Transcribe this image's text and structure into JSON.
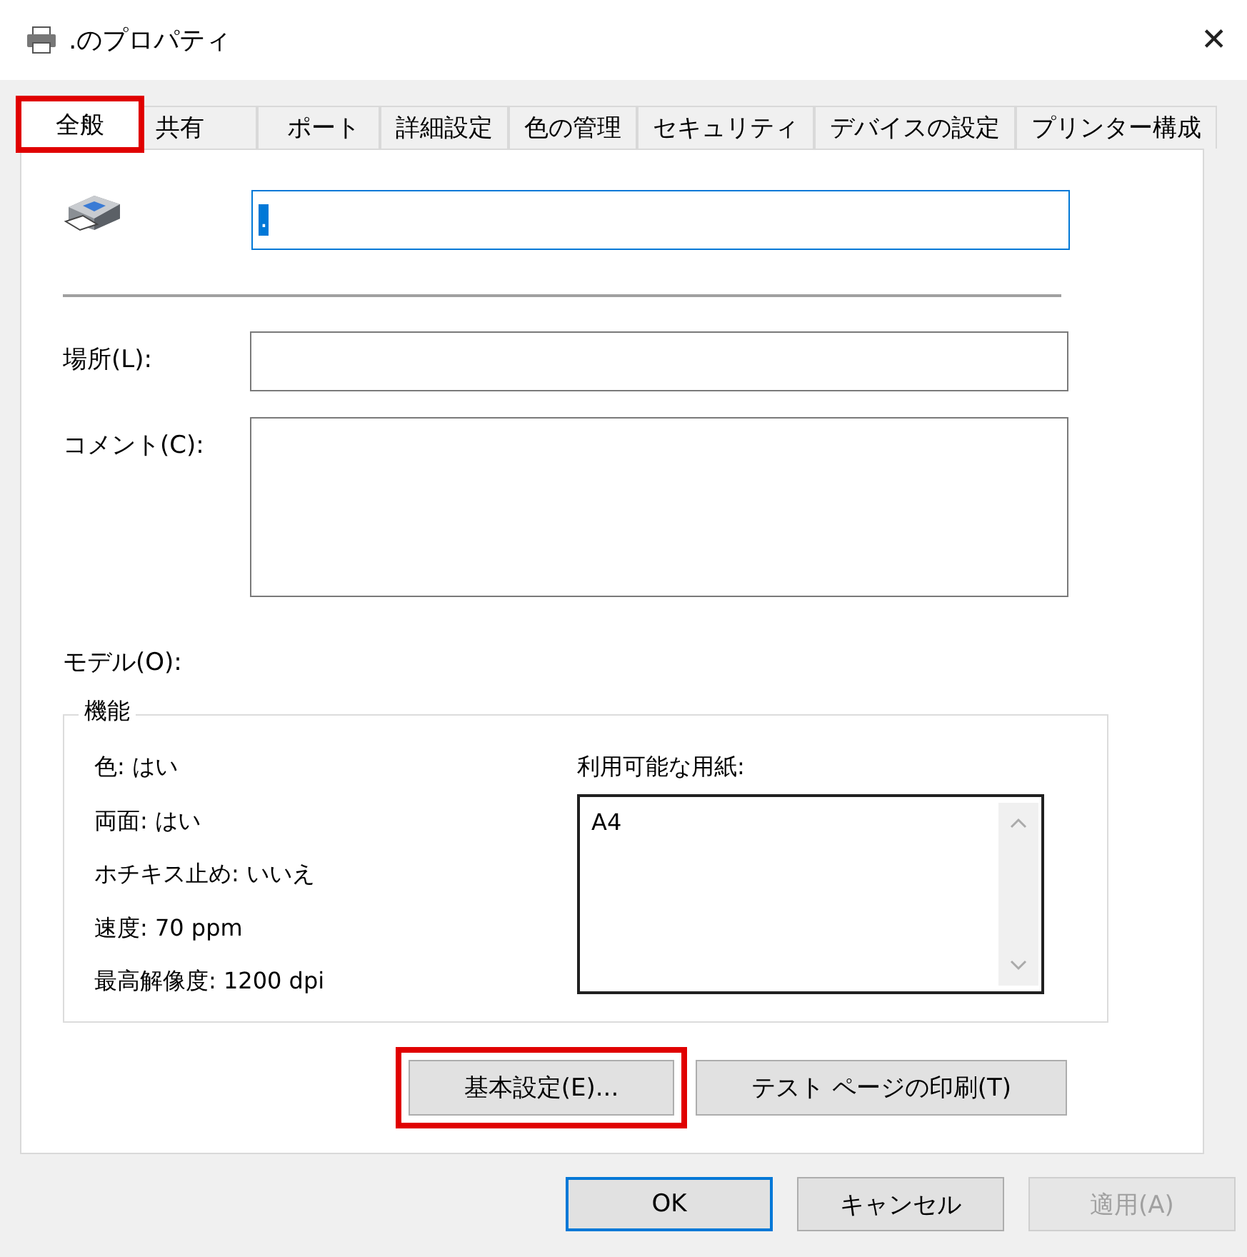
{
  "window": {
    "title": ".のプロパティ",
    "close": "✕"
  },
  "tabs": [
    {
      "label": "全般",
      "selected": true,
      "highlighted": true
    },
    {
      "label": "共有",
      "selected": false,
      "highlighted": false
    },
    {
      "label": "ポート",
      "selected": false,
      "highlighted": false
    },
    {
      "label": "詳細設定",
      "selected": false,
      "highlighted": false
    },
    {
      "label": "色の管理",
      "selected": false,
      "highlighted": false
    },
    {
      "label": "セキュリティ",
      "selected": false,
      "highlighted": false
    },
    {
      "label": "デバイスの設定",
      "selected": false,
      "highlighted": false
    },
    {
      "label": "プリンター構成",
      "selected": false,
      "highlighted": false
    }
  ],
  "name_field": {
    "value": "."
  },
  "location": {
    "label": "場所(L):"
  },
  "comment": {
    "label": "コメント(C):"
  },
  "model": {
    "label": "モデル(O):"
  },
  "features": {
    "title": "機能",
    "items": [
      "色: はい",
      "両面: はい",
      "ホチキス止め: いいえ",
      "速度: 70 ppm",
      "最高解像度: 1200 dpi"
    ],
    "paper_label": "利用可能な用紙:",
    "papers": [
      "A4"
    ]
  },
  "actions": [
    {
      "label": "基本設定(E)...",
      "highlighted": true
    },
    {
      "label": "テスト ページの印刷(T)",
      "highlighted": false
    }
  ],
  "buttons": [
    {
      "label": "OK",
      "kind": "default",
      "disabled": false
    },
    {
      "label": "キャンセル",
      "kind": "normal",
      "disabled": false
    },
    {
      "label": "適用(A)",
      "kind": "normal",
      "disabled": true
    }
  ]
}
